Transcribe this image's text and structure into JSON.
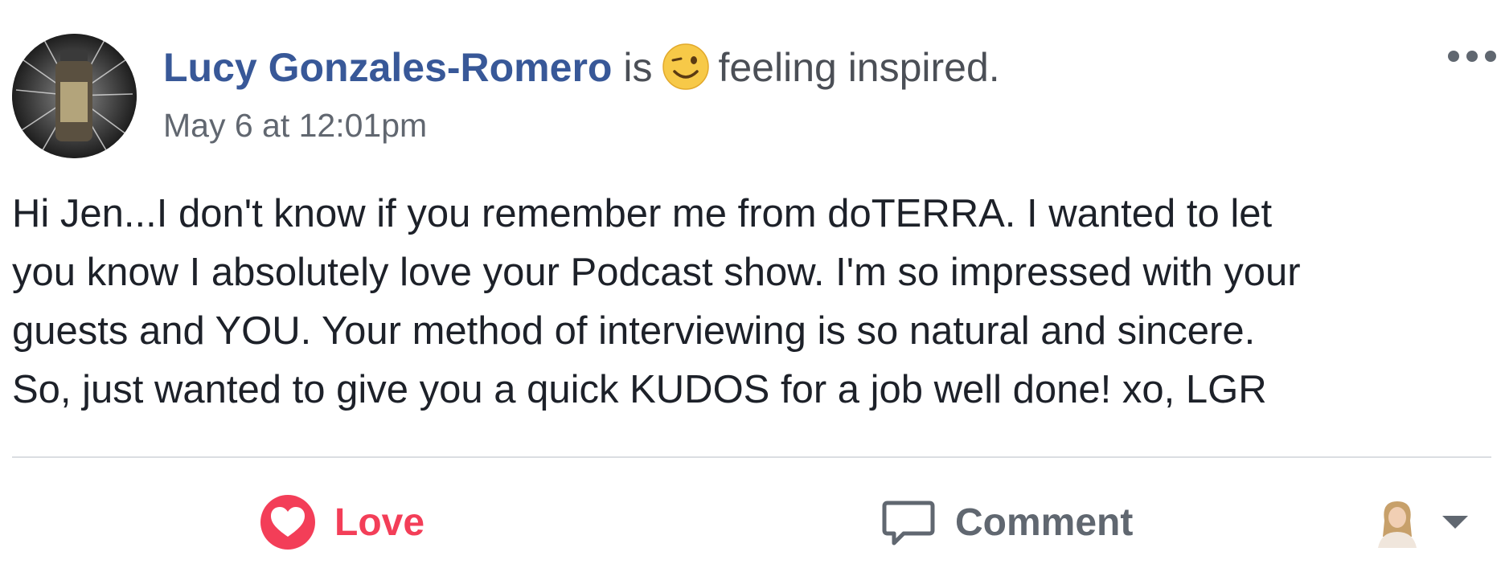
{
  "post": {
    "author": "Lucy Gonzales-Romero",
    "activity_prefix": "is",
    "feeling": "feeling inspired.",
    "feeling_icon": "winking-emoji-icon",
    "timestamp": "May 6 at 12:01pm",
    "message_lines": [
      "Hi Jen...I don't know if you remember me from doTERRA. I wanted to let",
      "you know I absolutely love your Podcast show. I'm so impressed with your",
      "guests and YOU. Your method of interviewing is so natural and sincere.",
      "So, just wanted to give you a quick KUDOS for a job well done! xo, LGR"
    ]
  },
  "actions": {
    "love_label": "Love",
    "comment_label": "Comment",
    "love_icon": "heart-icon",
    "comment_icon": "speech-bubble-icon",
    "audience_icon": "profile-avatar-icon"
  },
  "colors": {
    "author_link": "#385898",
    "love": "#f33e58",
    "muted": "#606770",
    "text": "#1d2129"
  }
}
